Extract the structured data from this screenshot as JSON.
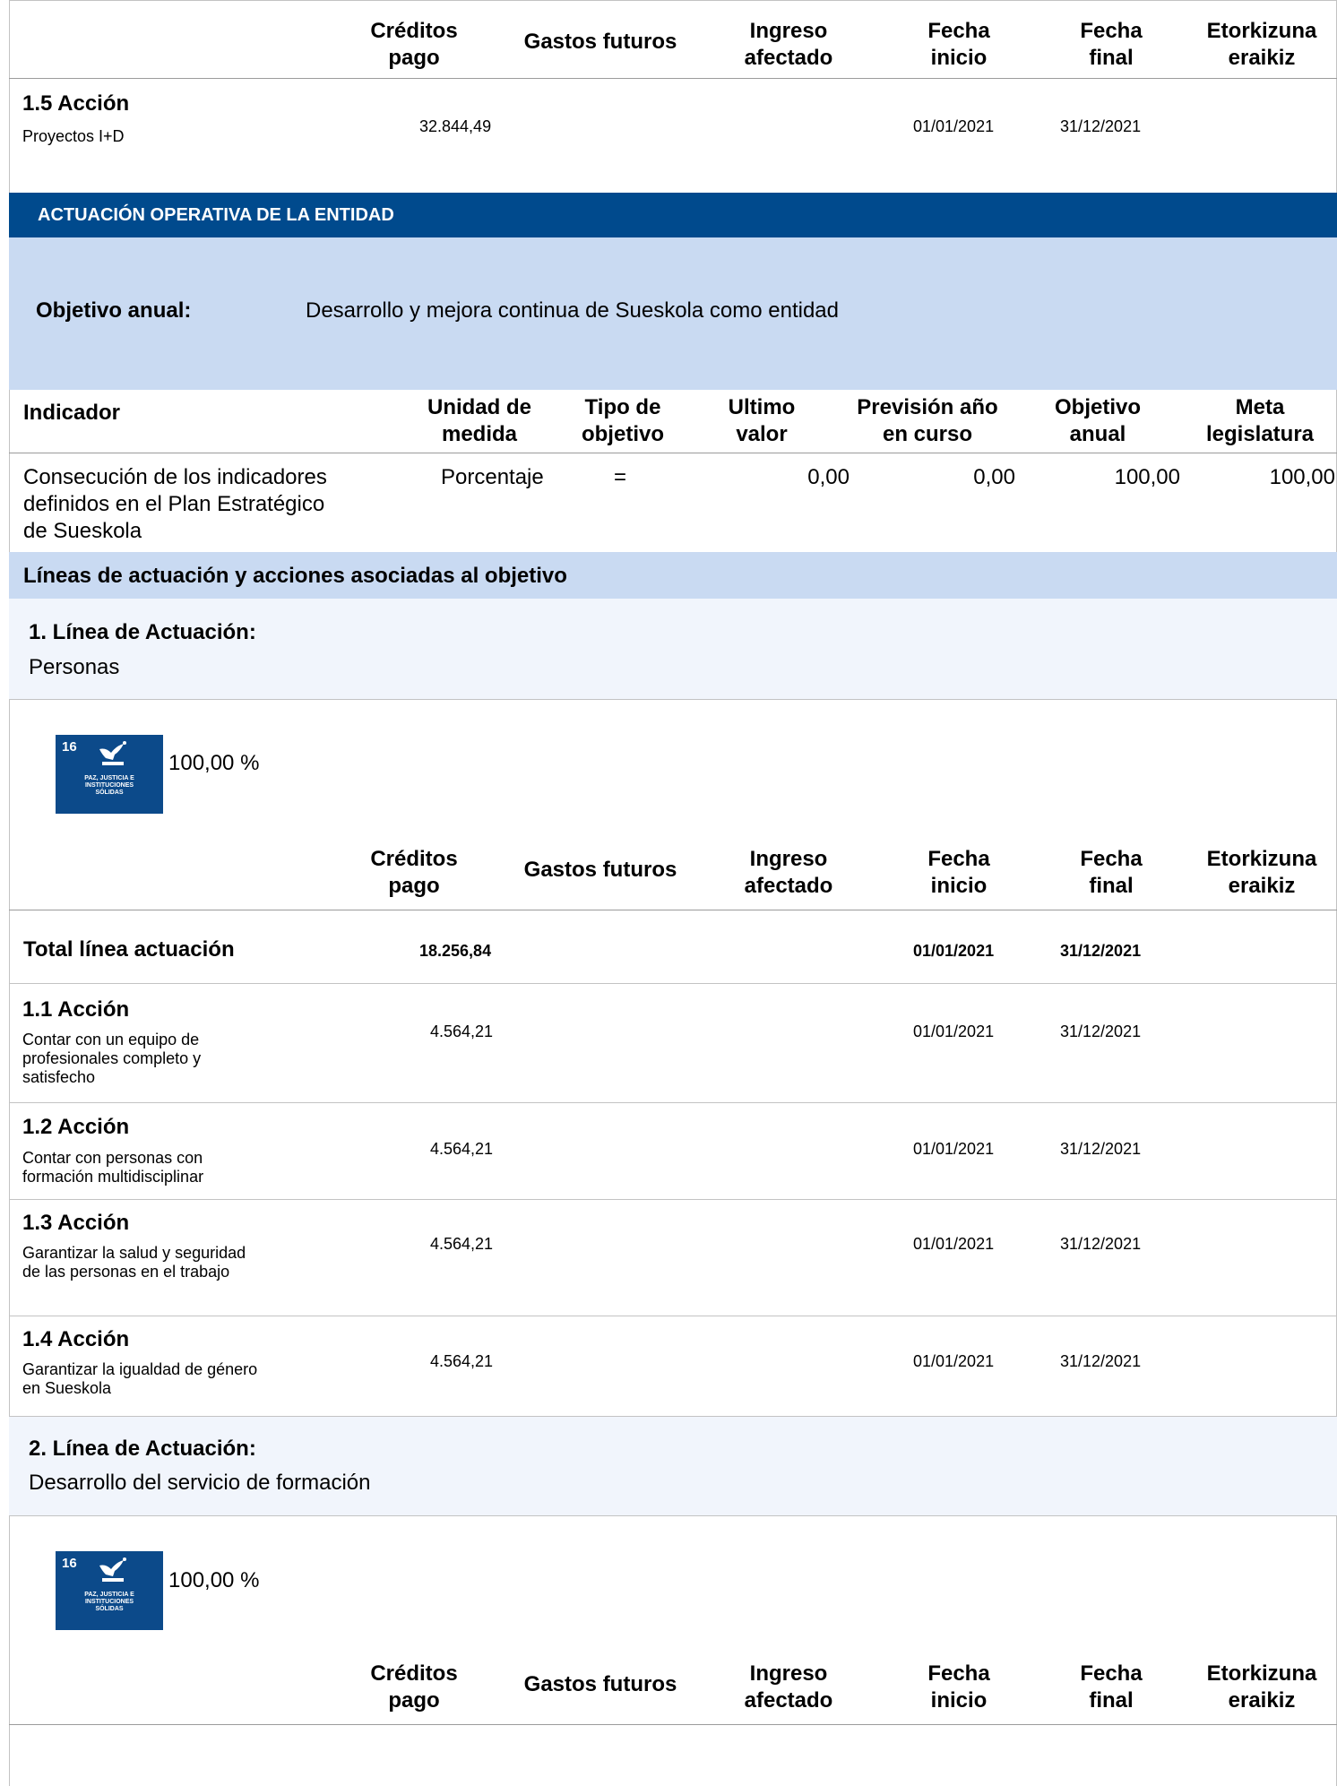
{
  "headers": {
    "creditos": [
      "Créditos",
      "pago"
    ],
    "gastos": "Gastos futuros",
    "ingreso": [
      "Ingreso",
      "afectado"
    ],
    "fecha_inicio": [
      "Fecha",
      "inicio"
    ],
    "fecha_final": [
      "Fecha",
      "final"
    ],
    "etorkizuna": [
      "Etorkizuna",
      "eraikiz"
    ]
  },
  "top_action": {
    "title": "1.5 Acción",
    "desc": "Proyectos I+D",
    "creditos": "32.844,49",
    "inicio": "01/01/2021",
    "final": "31/12/2021"
  },
  "section_title": "ACTUACIÓN OPERATIVA DE LA ENTIDAD",
  "objetivo": {
    "label": "Objetivo anual:",
    "text": "Desarrollo y mejora continua de Sueskola como entidad"
  },
  "indicator_headers": {
    "indicador": "Indicador",
    "unidad": [
      "Unidad de",
      "medida"
    ],
    "tipo": [
      "Tipo de",
      "objetivo"
    ],
    "ultimo": [
      "Ultimo",
      "valor"
    ],
    "prevision": [
      "Previsión año",
      "en curso"
    ],
    "objetivo": [
      "Objetivo",
      "anual"
    ],
    "meta": [
      "Meta",
      "legislatura"
    ]
  },
  "indicator_row": {
    "name": [
      "Consecución de los indicadores",
      "definidos en el Plan Estratégico",
      "de Sueskola"
    ],
    "unidad": "Porcentaje",
    "tipo": "=",
    "ultimo": "0,00",
    "prevision": "0,00",
    "objetivo": "100,00",
    "meta": "100,00"
  },
  "lineas_title": "Líneas de actuación y acciones asociadas al objetivo",
  "linea1": {
    "label": "1. Línea de Actuación:",
    "name": "Personas",
    "sdg_number": "16",
    "sdg_text": [
      "PAZ, JUSTICIA E",
      "INSTITUCIONES",
      "SÓLIDAS"
    ],
    "sdg_icon": "dove-gavel-icon",
    "pct": "100,00 %",
    "total_label": "Total línea actuación",
    "total_creditos": "18.256,84",
    "total_inicio": "01/01/2021",
    "total_final": "31/12/2021",
    "actions": [
      {
        "title": "1.1 Acción",
        "desc": [
          "Contar con un equipo de",
          "profesionales completo y",
          "satisfecho"
        ],
        "creditos": "4.564,21",
        "inicio": "01/01/2021",
        "final": "31/12/2021"
      },
      {
        "title": "1.2 Acción",
        "desc": [
          "Contar con personas con",
          "formación multidisciplinar"
        ],
        "creditos": "4.564,21",
        "inicio": "01/01/2021",
        "final": "31/12/2021"
      },
      {
        "title": "1.3 Acción",
        "desc": [
          "Garantizar la salud y seguridad",
          "de las personas en el trabajo"
        ],
        "creditos": "4.564,21",
        "inicio": "01/01/2021",
        "final": "31/12/2021"
      },
      {
        "title": "1.4 Acción",
        "desc": [
          "Garantizar la igualdad de género",
          "en Sueskola"
        ],
        "creditos": "4.564,21",
        "inicio": "01/01/2021",
        "final": "31/12/2021"
      }
    ]
  },
  "linea2": {
    "label": "2. Línea de Actuación:",
    "name": "Desarrollo del servicio de formación",
    "sdg_number": "16",
    "sdg_text": [
      "PAZ, JUSTICIA E",
      "INSTITUCIONES",
      "SÓLIDAS"
    ],
    "pct": "100,00 %"
  },
  "colors": {
    "section_band": "#004a8d",
    "light_band": "#c9daf2",
    "pale_band": "#f1f5fc",
    "sdg16": "#0c4a8a"
  }
}
